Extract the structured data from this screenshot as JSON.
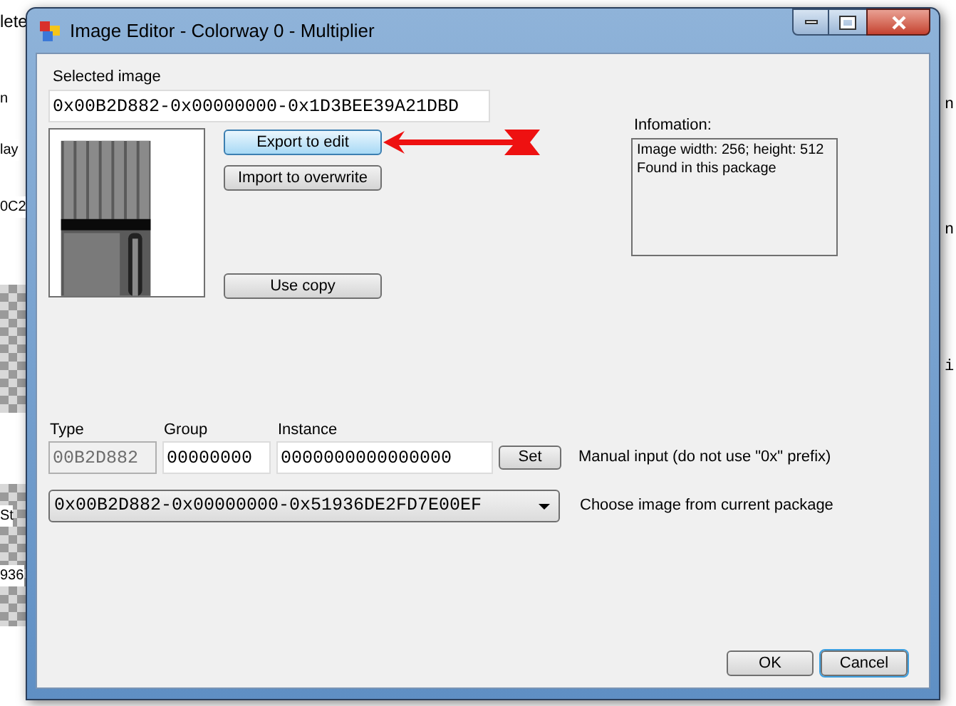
{
  "background_app": {
    "top_fragments": [
      "lete"
    ],
    "left_fragments": [
      "n",
      "lay",
      "0C2",
      "St",
      "936"
    ],
    "right_fragments": [
      "n",
      "n",
      "i"
    ]
  },
  "dialog": {
    "title": "Image Editor - Colorway 0 - Multiplier",
    "selected_image": {
      "label": "Selected image",
      "value": "0x00B2D882-0x00000000-0x1D3BEE39A21DBD"
    },
    "buttons": [
      {
        "label": "Export to edit",
        "highlighted": true
      },
      {
        "label": "Import to overwrite",
        "highlighted": false
      },
      {
        "label": "Use copy",
        "highlighted": false
      }
    ],
    "information": {
      "label": "Infomation:",
      "lines": [
        "Image width: 256; height: 512",
        "Found in this package"
      ]
    },
    "fields": [
      {
        "label": "Type",
        "value": "00B2D882",
        "disabled": true
      },
      {
        "label": "Group",
        "value": "00000000",
        "disabled": false
      },
      {
        "label": "Instance",
        "value": "0000000000000000",
        "disabled": false
      }
    ],
    "set_button": "Set",
    "manual_hint": "Manual input (do not use \"0x\" prefix)",
    "combo": {
      "value": "0x00B2D882-0x00000000-0x51936DE2FD7E00EF"
    },
    "combo_hint": "Choose image from current package",
    "bottom_buttons": [
      {
        "label": "OK",
        "focused": false
      },
      {
        "label": "Cancel",
        "focused": true
      }
    ]
  }
}
